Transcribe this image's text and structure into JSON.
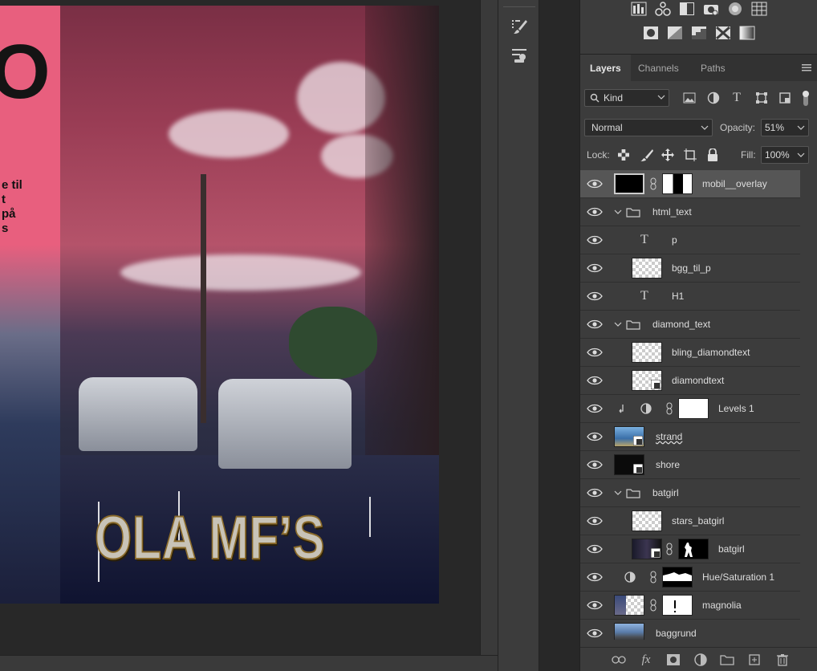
{
  "canvas": {
    "big_letter": "O",
    "side_text_lines": [
      "e til",
      "t",
      "på",
      "s"
    ],
    "title_logo": "OLA MF’S"
  },
  "tool_strip": {
    "tools": [
      {
        "icon": "brush-settings-icon"
      },
      {
        "icon": "clone-source-icon"
      }
    ]
  },
  "adjustments": {
    "row1": [
      "levels-icon",
      "balance-icon",
      "black-white-icon",
      "camera-icon",
      "channel-mixer-icon",
      "color-lookup-icon"
    ],
    "row2": [
      "invert-icon",
      "posterize-icon",
      "threshold-icon",
      "selective-color-icon",
      "gradient-map-icon"
    ]
  },
  "tabs": [
    {
      "label": "Layers",
      "active": true
    },
    {
      "label": "Channels",
      "active": false
    },
    {
      "label": "Paths",
      "active": false
    }
  ],
  "filter": {
    "kind_label": "Kind",
    "icons": [
      "image-filter-icon",
      "adjustment-filter-icon",
      "type-filter-icon",
      "shape-filter-icon",
      "smart-object-filter-icon"
    ]
  },
  "blend": {
    "mode": "Normal",
    "opacity_label": "Opacity:",
    "opacity_value": "51%"
  },
  "lock": {
    "label": "Lock:",
    "icons": [
      "lock-transparent-icon",
      "lock-image-icon",
      "lock-position-icon",
      "lock-artboard-icon",
      "lock-all-icon"
    ],
    "fill_label": "Fill:",
    "fill_value": "100%"
  },
  "layers": [
    {
      "name": "mobil__overlay",
      "type": "masked",
      "selected": true
    },
    {
      "name": "html_text",
      "type": "group"
    },
    {
      "name": "p",
      "type": "text",
      "indent": 1
    },
    {
      "name": "bgg_til_p",
      "type": "pixel",
      "indent": 1
    },
    {
      "name": "H1",
      "type": "text",
      "indent": 1
    },
    {
      "name": "diamond_text",
      "type": "group"
    },
    {
      "name": "bling_diamondtext",
      "type": "pixel",
      "indent": 1
    },
    {
      "name": "diamondtext",
      "type": "smart",
      "indent": 1
    },
    {
      "name": "Levels 1",
      "type": "adjustment-clipped"
    },
    {
      "name": "strand",
      "type": "smart-photo"
    },
    {
      "name": "shore",
      "type": "smart-photo-dark"
    },
    {
      "name": "batgirl",
      "type": "group"
    },
    {
      "name": "stars_batgirl",
      "type": "pixel",
      "indent": 1
    },
    {
      "name": "batgirl",
      "type": "smart-masked",
      "indent": 1
    },
    {
      "name": "Hue/Saturation 1",
      "type": "adjustment-masked"
    },
    {
      "name": "magnolia",
      "type": "smart-masked-white"
    },
    {
      "name": "baggrund",
      "type": "photo"
    }
  ],
  "bottom_bar": {
    "fx_label": "fx",
    "icons": [
      "link-layers-icon",
      "fx-icon",
      "add-mask-icon",
      "new-adjustment-icon",
      "new-group-icon",
      "new-layer-icon",
      "delete-layer-icon"
    ]
  }
}
